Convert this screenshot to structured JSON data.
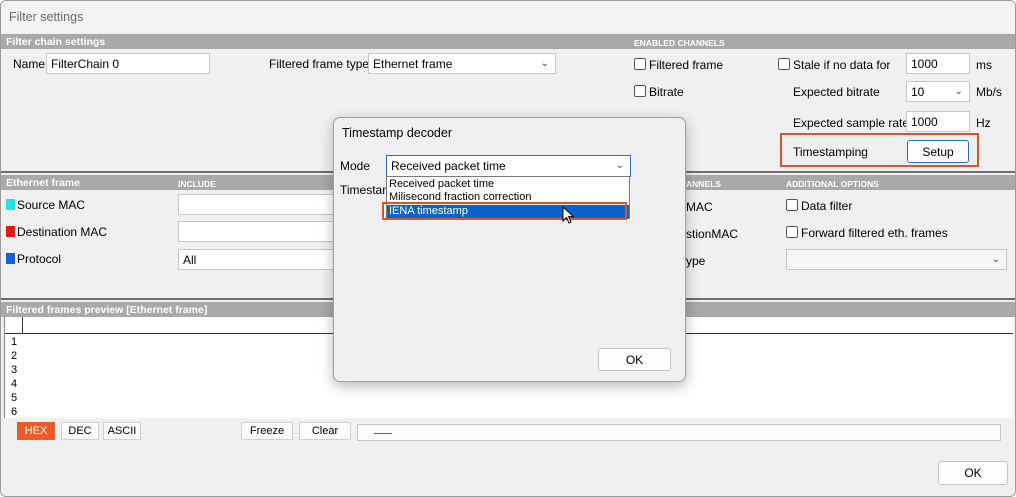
{
  "window": {
    "title": "Filter settings"
  },
  "filter_chain": {
    "header": "Filter chain settings",
    "name_label": "Name",
    "name_value": "FilterChain 0",
    "frame_type_label": "Filtered frame type",
    "frame_type_value": "Ethernet frame"
  },
  "enabled_channels": {
    "header": "ENABLED CHANNELS",
    "filtered_frame_label": "Filtered frame",
    "bitrate_label": "Bitrate",
    "stale_label": "Stale if no data for",
    "stale_value": "1000",
    "stale_unit": "ms",
    "expected_bitrate_label": "Expected bitrate",
    "expected_bitrate_value": "10",
    "expected_bitrate_unit": "Mb/s",
    "expected_sample_rate_label": "Expected sample rate",
    "expected_sample_rate_value": "1000",
    "expected_sample_rate_unit": "Hz",
    "timestamping_label": "Timestamping",
    "setup_button": "Setup"
  },
  "ethernet_frame": {
    "header": "Ethernet frame",
    "include_header": "INCLUDE",
    "channels_header": "ANNELS",
    "additional_header": "ADDITIONAL OPTIONS",
    "fields": [
      {
        "label": "Source MAC",
        "color": "#1ee3e3"
      },
      {
        "label": "Destination MAC",
        "color": "#e01b1b"
      },
      {
        "label": "Protocol",
        "color": "#1560d8"
      }
    ],
    "protocol_value": "All",
    "channel_labels": [
      "MAC",
      "stionMAC",
      "ype"
    ],
    "data_filter_label": "Data filter",
    "forward_label": "Forward filtered eth. frames"
  },
  "preview": {
    "header": "Filtered frames preview [Ethernet frame]",
    "rows": [
      "1",
      "2",
      "3",
      "4",
      "5",
      "6"
    ],
    "format_buttons": [
      {
        "label": "HEX",
        "active": true
      },
      {
        "label": "DEC",
        "active": false
      },
      {
        "label": "ASCII",
        "active": false
      }
    ],
    "freeze_button": "Freeze",
    "clear_button": "Clear"
  },
  "ok_button": "OK",
  "dialog": {
    "title": "Timestamp decoder",
    "mode_label": "Mode",
    "mode_value": "Received packet time",
    "timestamp_label_partial": "Timestam",
    "options": [
      "Received packet time",
      "Milisecond fraction correction",
      "IENA timestamp"
    ],
    "highlighted_index": 2,
    "ok_button": "OK"
  },
  "colors": {
    "accent": "#ee5a2a",
    "highlight_box": "#d9532e",
    "selection": "#0a64c8",
    "section_header": "#a9a9a9"
  }
}
